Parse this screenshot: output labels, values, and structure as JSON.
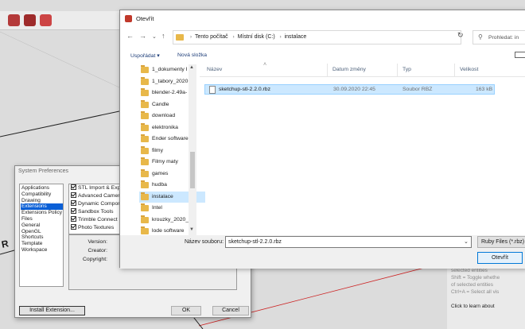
{
  "dialog": {
    "title": "Otevřít",
    "breadcrumb": [
      "Tento počítač",
      "Místní disk (C:)",
      "instalace"
    ],
    "search_placeholder": "Prohledat: in",
    "commands": {
      "organize": "Uspořádat ▾",
      "new_folder": "Nová složka"
    },
    "columns": {
      "name": "Název",
      "date": "Datum změny",
      "type": "Typ",
      "size": "Velikost"
    },
    "folders": [
      "1_dokumenty I",
      "1_tabory_2020",
      "blender-2.49a-",
      "Candle",
      "download",
      "elektronika",
      "Ender software",
      "filmy",
      "Filmy maty",
      "games",
      "hudba",
      "instalace",
      "Intel",
      "krouzky_2020_2",
      "lode software"
    ],
    "selected_folder_index": 11,
    "file": {
      "name": "sketchup-stl-2.2.0.rbz",
      "date": "30.09.2020 22:45",
      "type": "Soubor RBZ",
      "size": "163 kB"
    },
    "filename_label": "Název souboru:",
    "filename_value": "sketchup-stl-2.2.0.rbz",
    "filetype_value": "Ruby Files (*.rbz)",
    "open_button": "Otevřít"
  },
  "prefs": {
    "title": "System Preferences",
    "categories": [
      "Applications",
      "Compatibility",
      "Drawing",
      "Extensions",
      "Extensions Policy",
      "Files",
      "General",
      "OpenGL",
      "Shortcuts",
      "Template",
      "Workspace"
    ],
    "selected_category_index": 3,
    "extensions": [
      "STL Import & Expo",
      "Advanced Camera",
      "Dynamic Compone",
      "Sandbox Tools",
      "Trimble Connect",
      "Photo Textures"
    ],
    "details": {
      "version": "Version:",
      "creator": "Creator:",
      "copyright": "Copyright:"
    },
    "install_button": "Install Extension...",
    "ok_button": "OK",
    "cancel_button": "Cancel"
  },
  "side_panel": {
    "lines": [
      "entities",
      "Shift+Ctrl = Subtract",
      "selected entities",
      "Shift = Toggle whethe",
      "of selected entities",
      "Ctrl+A = Select all vis",
      "",
      "Click to learn about"
    ]
  },
  "bg_text": "R",
  "colors": {
    "selection": "#cce8ff",
    "accent": "#0078d7",
    "folder": "#e8b84a",
    "red_axis": "#cc2222"
  }
}
